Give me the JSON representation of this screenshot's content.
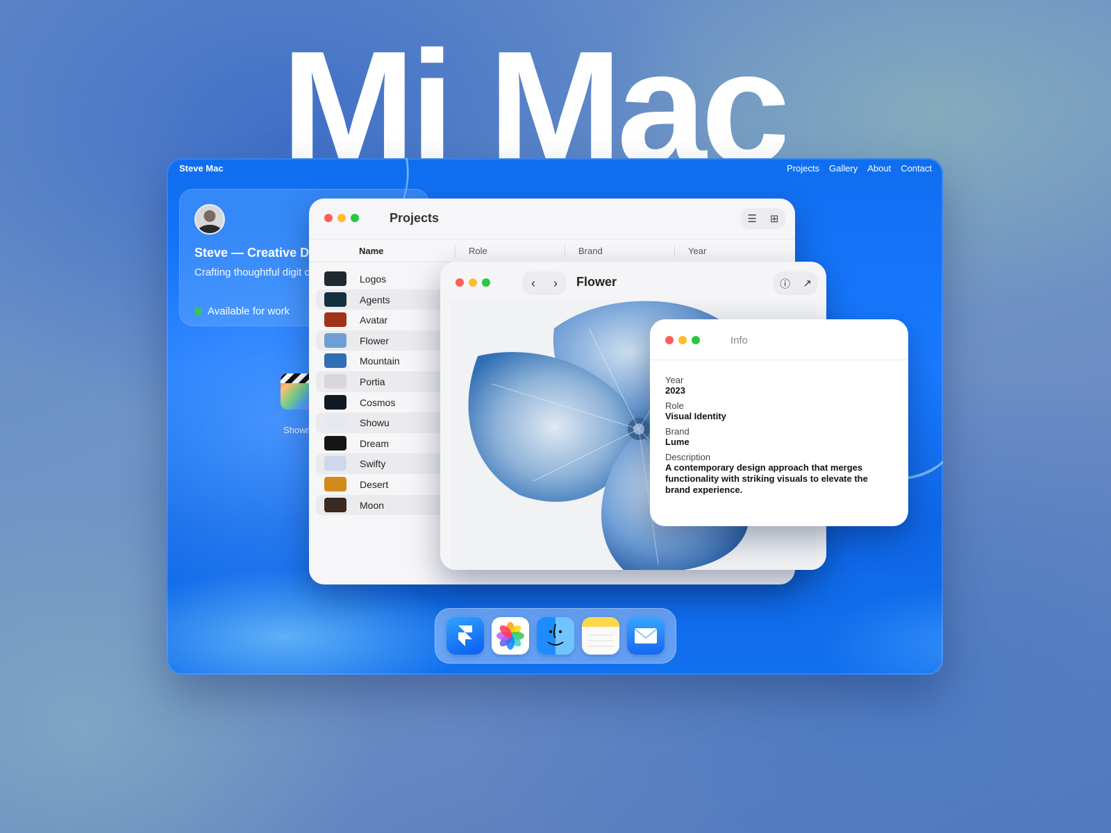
{
  "hero": {
    "title": "Mi Mac"
  },
  "topbar": {
    "brand": "Steve Mac",
    "nav": [
      "Projects",
      "Gallery",
      "About",
      "Contact"
    ]
  },
  "profile": {
    "name": "Steve — Creative De",
    "tagline": "Crafting thoughtful digit clarity and purpose.",
    "status": "Available for work",
    "status_color": "#34c759"
  },
  "desktop_icons": [
    {
      "label": "Showre",
      "icon": "final-cut-clapper-icon"
    }
  ],
  "projects_window": {
    "title": "Projects",
    "view_icons": [
      "list-view-icon",
      "grid-view-icon"
    ],
    "columns": [
      "Name",
      "Role",
      "Brand",
      "Year"
    ],
    "rows": [
      {
        "name": "Logos",
        "thumb": "#1d2b2f"
      },
      {
        "name": "Agents",
        "thumb": "#13303f"
      },
      {
        "name": "Avatar",
        "thumb": "#a0331a"
      },
      {
        "name": "Flower",
        "thumb": "#6f9ed6"
      },
      {
        "name": "Mountain",
        "thumb": "#2f6fb5"
      },
      {
        "name": "Portia",
        "thumb": "#d8d8dc"
      },
      {
        "name": "Cosmos",
        "thumb": "#111922"
      },
      {
        "name": "Showu",
        "thumb": "#e6e9f0"
      },
      {
        "name": "Dream",
        "thumb": "#151515"
      },
      {
        "name": "Swifty",
        "thumb": "#cfd8ea"
      },
      {
        "name": "Desert",
        "thumb": "#d28a1c"
      },
      {
        "name": "Moon",
        "thumb": "#3a2a1f"
      }
    ]
  },
  "flower_window": {
    "title": "Flower",
    "nav": [
      "‹",
      "›"
    ],
    "actions": [
      "ⓘ",
      "↗"
    ]
  },
  "info_window": {
    "title": "Info",
    "fields": [
      {
        "label": "Year",
        "value": "2023"
      },
      {
        "label": "Role",
        "value": "Visual Identity"
      },
      {
        "label": "Brand",
        "value": "Lume"
      }
    ],
    "description_label": "Description",
    "description": "A contemporary design approach that merges functionality with striking visuals to elevate the brand experience."
  },
  "dock": {
    "apps": [
      "framer-app-icon",
      "photos-app-icon",
      "finder-app-icon",
      "notes-app-icon",
      "mail-app-icon"
    ]
  },
  "colors": {
    "desktop_blue": "#1a7aff",
    "light_red": "#ff5f57",
    "light_yellow": "#febc2e",
    "light_green": "#28c840"
  }
}
